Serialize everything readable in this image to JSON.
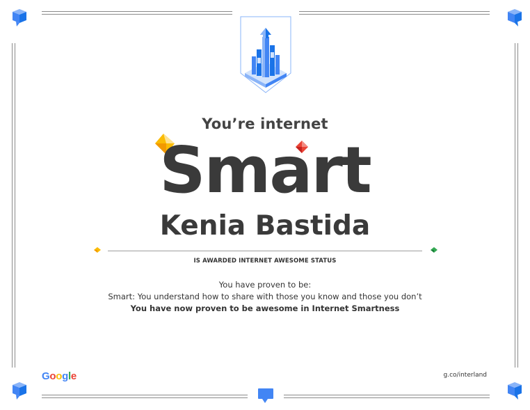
{
  "certificate": {
    "subtitle": "You’re internet",
    "headline": "Smart",
    "recipient_name": "Kenia Bastida",
    "award_statement": "IS AWARDED INTERNET AWESOME STATUS",
    "proven_intro": "You have proven to be:",
    "proven_detail": "Smart: You understand how to share with those you know and those you don’t",
    "proven_closing": "You have now proven to be awesome in Internet Smartness"
  },
  "footer": {
    "logo_letters": [
      "G",
      "o",
      "o",
      "g",
      "l",
      "e"
    ],
    "logo_colors": [
      "#4285f4",
      "#ea4335",
      "#fbbc05",
      "#4285f4",
      "#34a853",
      "#ea4335"
    ],
    "site_link": "g.co/interland"
  },
  "icons": {
    "badge": "city-tower-badge-icon",
    "corner": "speech-bubble-cube-icon",
    "bottom_center": "speech-bubble-icon",
    "gems": [
      "yellow-gem-icon",
      "red-gem-icon",
      "green-gem-icon"
    ]
  },
  "colors": {
    "text": "#3c3c3c",
    "brand_blue": "#4285f4",
    "gem_yellow": "#fbbc05",
    "gem_red": "#ea4335",
    "gem_green": "#34a853"
  }
}
